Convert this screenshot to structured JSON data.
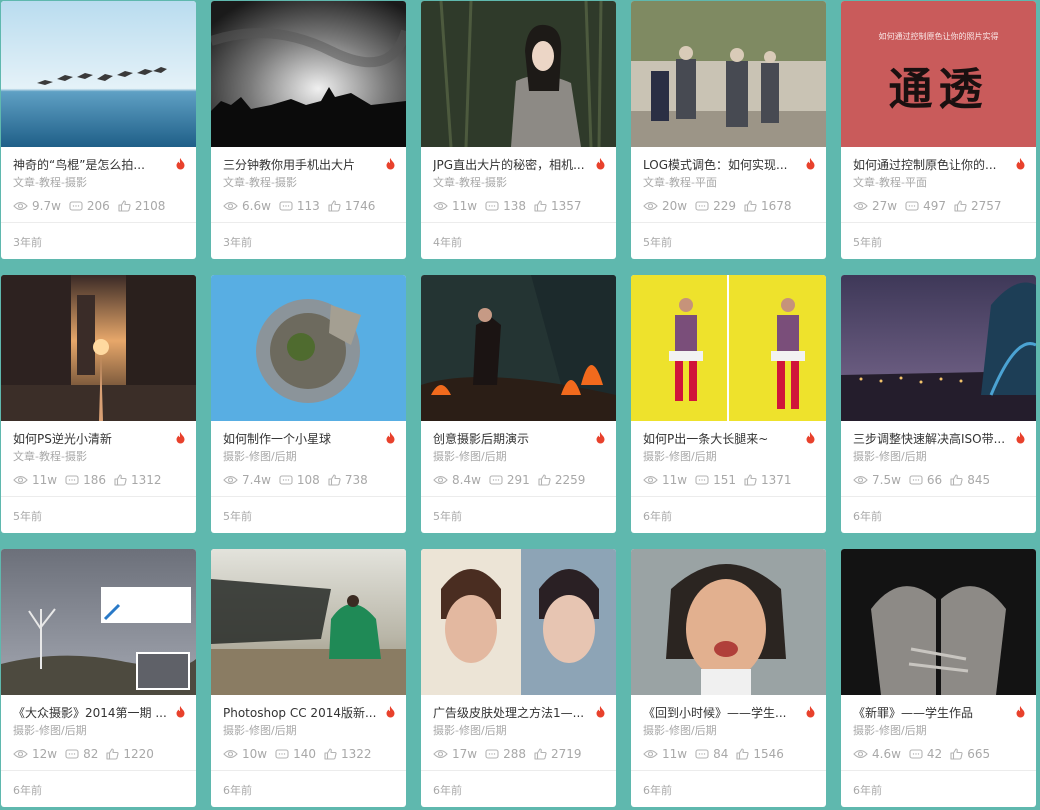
{
  "cards": [
    {
      "title": "神奇的“鸟棍”是怎么拍...",
      "category": "文章-教程-摄影",
      "views": "9.7w",
      "comments": "206",
      "likes": "2108",
      "time": "3年前",
      "image": "birds-over-sea"
    },
    {
      "title": "三分钟教你用手机出大片",
      "category": "文章-教程-摄影",
      "views": "6.6w",
      "comments": "113",
      "likes": "1746",
      "time": "3年前",
      "image": "bw-sky-skyline"
    },
    {
      "title": "JPG直出大片的秘密，相机...",
      "category": "文章-教程-摄影",
      "views": "11w",
      "comments": "138",
      "likes": "1357",
      "time": "4年前",
      "image": "woman-bamboo-portrait"
    },
    {
      "title": "LOG模式调色：如何实现...",
      "category": "文章-教程-平面",
      "views": "20w",
      "comments": "229",
      "likes": "1678",
      "time": "5年前",
      "image": "street-pedestrians"
    },
    {
      "title": "如何通过控制原色让你的...",
      "category": "文章-教程-平面",
      "views": "27w",
      "comments": "497",
      "likes": "2757",
      "time": "5年前",
      "image": "calligraphy-red-poster",
      "image_caption": "如何通过控制原色让你的照片实得",
      "image_text": "通透"
    },
    {
      "title": "如何PS逆光小清新",
      "category": "文章-教程-摄影",
      "views": "11w",
      "comments": "186",
      "likes": "1312",
      "time": "5年前",
      "image": "city-street-sunset"
    },
    {
      "title": "如何制作一个小星球",
      "category": "摄影-修图/后期",
      "views": "7.4w",
      "comments": "108",
      "likes": "738",
      "time": "5年前",
      "image": "tiny-planet"
    },
    {
      "title": "创意摄影后期演示",
      "category": "摄影-修图/后期",
      "views": "8.4w",
      "comments": "291",
      "likes": "2259",
      "time": "5年前",
      "image": "warrior-fire"
    },
    {
      "title": "如何P出一条大长腿来~",
      "category": "摄影-修图/后期",
      "views": "11w",
      "comments": "151",
      "likes": "1371",
      "time": "6年前",
      "image": "yellow-wall-model"
    },
    {
      "title": "三步调整快速解决高ISO带...",
      "category": "摄影-修图/后期",
      "views": "7.5w",
      "comments": "66",
      "likes": "845",
      "time": "6年前",
      "image": "night-bridge-city"
    },
    {
      "title": "《大众摄影》2014第一期 ...",
      "category": "摄影-修图/后期",
      "views": "12w",
      "comments": "82",
      "likes": "1220",
      "time": "6年前",
      "image": "winter-tree-landscape"
    },
    {
      "title": "Photoshop CC 2014版新...",
      "category": "摄影-修图/后期",
      "views": "10w",
      "comments": "140",
      "likes": "1322",
      "time": "6年前",
      "image": "dancer-green-dress"
    },
    {
      "title": "广告级皮肤处理之方法1—...",
      "category": "摄影-修图/后期",
      "views": "17w",
      "comments": "288",
      "likes": "2719",
      "time": "6年前",
      "image": "beauty-retouch-before-after"
    },
    {
      "title": "《回到小时候》——学生...",
      "category": "摄影-修图/后期",
      "views": "11w",
      "comments": "84",
      "likes": "1546",
      "time": "6年前",
      "image": "caricature-face"
    },
    {
      "title": "《新罪》——学生作品",
      "category": "摄影-修图/后期",
      "views": "4.6w",
      "comments": "42",
      "likes": "665",
      "time": "6年前",
      "image": "bound-fists"
    }
  ],
  "icons": {
    "views": "eye-icon",
    "comments": "comment-icon",
    "likes": "thumbs-up-icon",
    "hot": "fire-icon"
  },
  "colors": {
    "background": "#5fb8ae",
    "hot": "#e8412c",
    "muted": "#a8a8a8"
  }
}
